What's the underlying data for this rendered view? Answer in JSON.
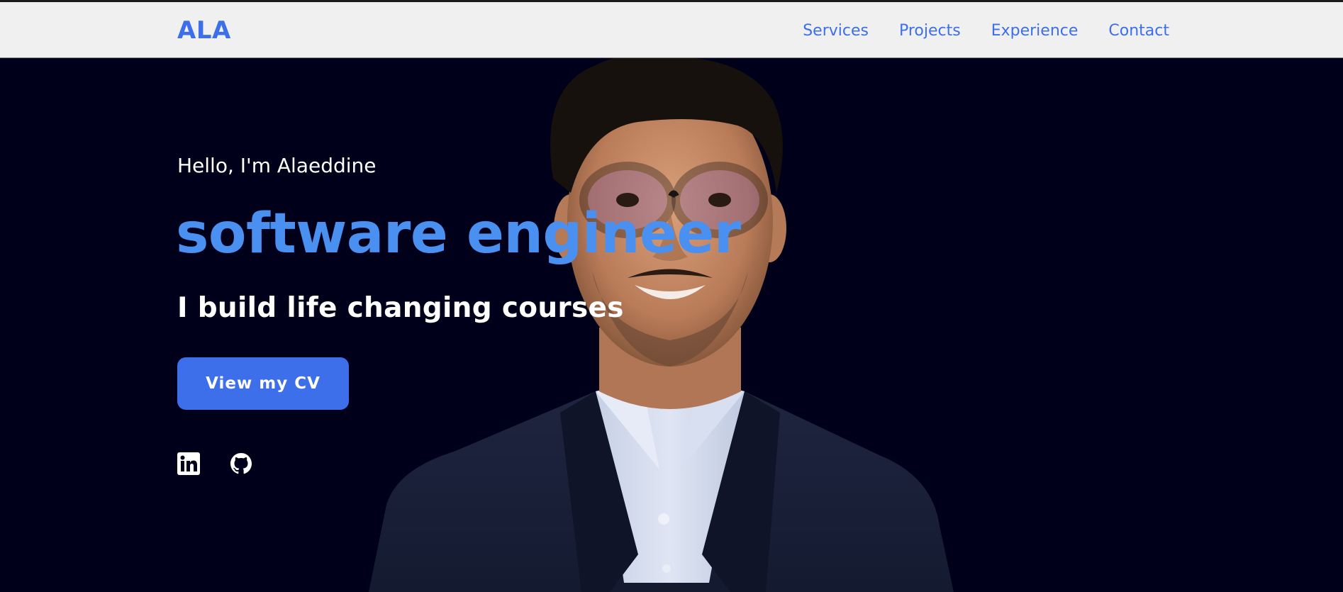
{
  "navbar": {
    "logo": "ALA",
    "links": [
      {
        "label": "Services"
      },
      {
        "label": "Projects"
      },
      {
        "label": "Experience"
      },
      {
        "label": "Contact"
      }
    ]
  },
  "hero": {
    "greeting": "Hello, I'm Alaeddine",
    "role": "software engineer",
    "tagline": "I build life changing courses",
    "cv_button_label": "View my CV",
    "social": [
      {
        "icon": "linkedin-icon"
      },
      {
        "icon": "github-icon"
      }
    ]
  },
  "colors": {
    "accent": "#3d6fea",
    "role_text": "#4a90f0",
    "background": "#01001a",
    "navbar_bg": "#f0f0f0"
  }
}
